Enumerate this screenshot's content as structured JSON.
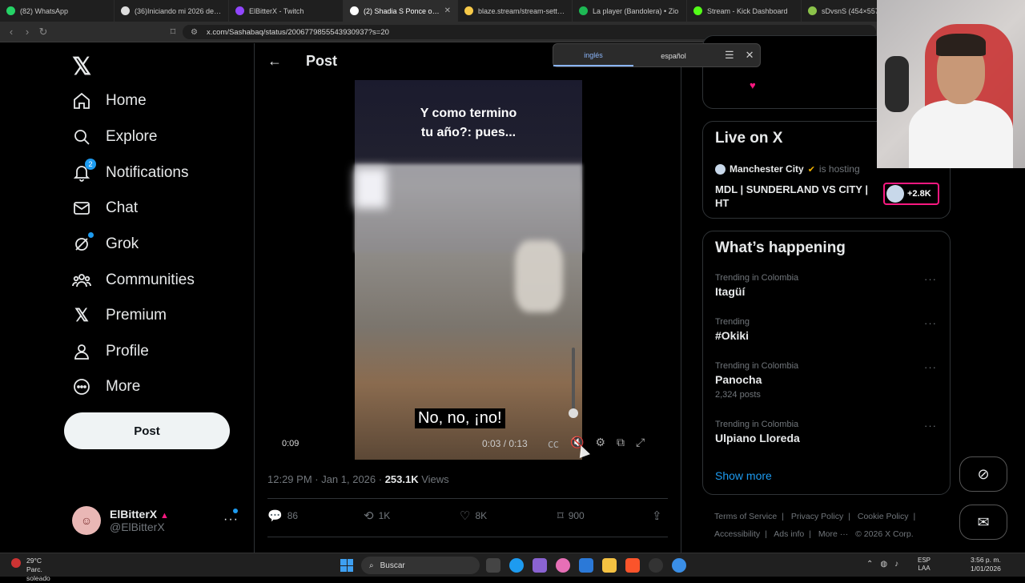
{
  "browser": {
    "tabs": [
      {
        "title": "(82) WhatsApp",
        "color": "#25d366",
        "active": false
      },
      {
        "title": "(36)Iniciando mi 2026 de la me...",
        "color": "#ffffff",
        "active": false
      },
      {
        "title": "ElBitterX - Twitch",
        "color": "#9146ff",
        "active": false
      },
      {
        "title": "(2) Shadia S Ponce on X: \"",
        "color": "#ffffff",
        "active": true
      },
      {
        "title": "blaze.stream/stream-settings",
        "color": "#f7c948",
        "active": false
      },
      {
        "title": "La player (Bandolera) • Zio",
        "color": "#1db954",
        "active": false
      },
      {
        "title": "Stream - Kick Dashboard",
        "color": "#53fc18",
        "active": false
      },
      {
        "title": "sDvsnS (454×557)",
        "color": "#8bc34a",
        "active": false
      }
    ],
    "url": "x.com/Sashabaq/status/2006779855543930937?s=20"
  },
  "translate": {
    "lang_from": "inglés",
    "lang_to": "español"
  },
  "nav": {
    "items": [
      {
        "label": "Home",
        "icon": "home-icon"
      },
      {
        "label": "Explore",
        "icon": "search-icon"
      },
      {
        "label": "Notifications",
        "icon": "bell-icon",
        "badge": "2"
      },
      {
        "label": "Chat",
        "icon": "mail-icon"
      },
      {
        "label": "Grok",
        "icon": "grok-icon"
      },
      {
        "label": "Communities",
        "icon": "communities-icon"
      },
      {
        "label": "Premium",
        "icon": "x-premium-icon"
      },
      {
        "label": "Profile",
        "icon": "person-icon"
      },
      {
        "label": "More",
        "icon": "more-circle-icon"
      }
    ],
    "post_button": "Post"
  },
  "account": {
    "name": "ElBitterX",
    "handle": "@ElBitterX"
  },
  "main": {
    "title": "Post",
    "video": {
      "caption_top_line1": "Y como termino",
      "caption_top_line2": "tu año?: pues...",
      "subtitle": "No, no, ¡no!",
      "elapsed_left": "0:09",
      "time": "0:03 / 0:13"
    },
    "meta": {
      "time": "12:29 PM · Jan 1, 2026 · ",
      "views_count": "253.1K",
      "views_label": " Views"
    },
    "actions": {
      "replies": "86",
      "reposts": "1K",
      "likes": "8K",
      "bookmarks": "900"
    }
  },
  "right": {
    "live": {
      "heading": "Live on X",
      "host": "Manchester City",
      "hosting": "is hosting",
      "title": "MDL | SUNDERLAND VS CITY | HT",
      "viewers": "+2.8K"
    },
    "happening": {
      "heading": "What’s happening",
      "trends": [
        {
          "category": "Trending in Colombia",
          "name": "Itagüí",
          "count": ""
        },
        {
          "category": "Trending",
          "name": "#Okiki",
          "count": ""
        },
        {
          "category": "Trending in Colombia",
          "name": "Panocha",
          "count": "2,324 posts"
        },
        {
          "category": "Trending in Colombia",
          "name": "Ulpiano Lloreda",
          "count": ""
        }
      ],
      "show_more": "Show more"
    },
    "footer": [
      "Terms of Service",
      "|",
      "Privacy Policy",
      "|",
      "Cookie Policy",
      "|",
      "Accessibility",
      "|",
      "Ads info",
      "|",
      "More ···",
      "© 2026 X Corp."
    ]
  },
  "taskbar": {
    "temp": "29°C",
    "weather": "Parc. soleado",
    "search": "Buscar",
    "lang1": "ESP",
    "lang2": "LAA",
    "time": "3:56 p. m.",
    "date": "1/01/2026"
  }
}
